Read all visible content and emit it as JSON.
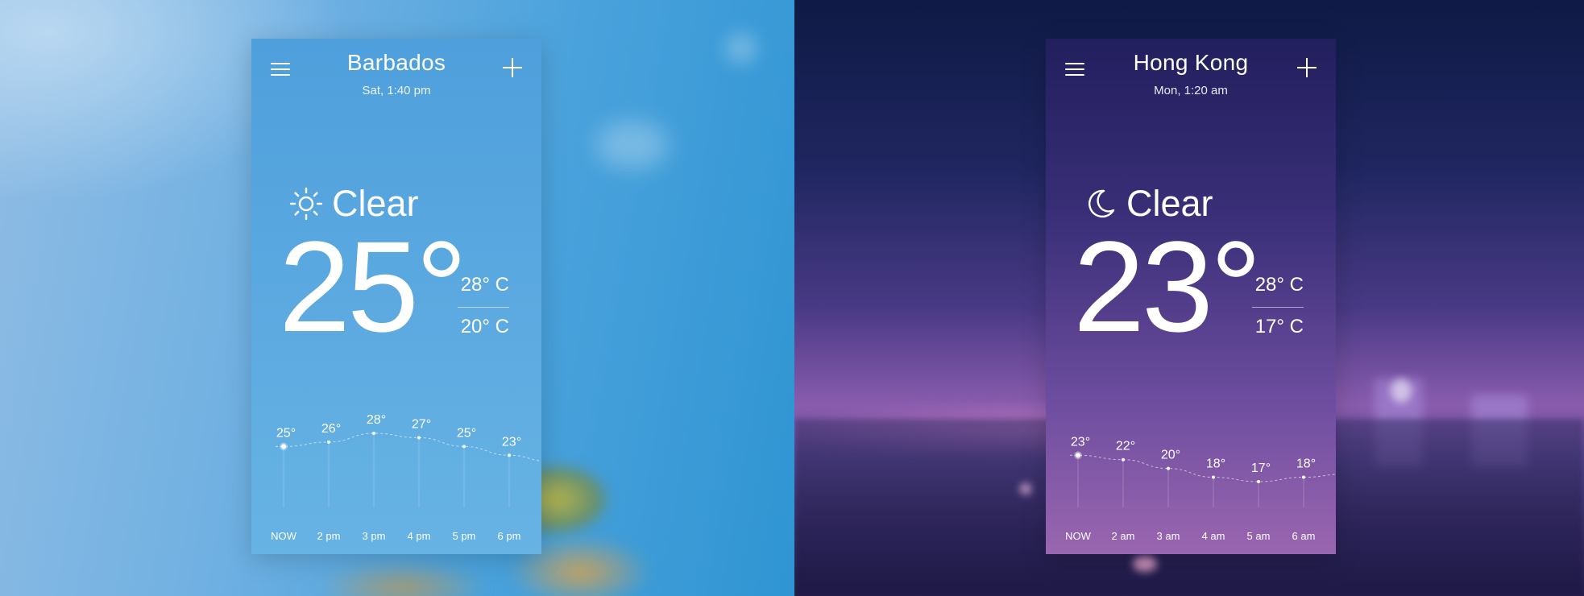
{
  "cards": {
    "barbados": {
      "city": "Barbados",
      "datetime": "Sat, 1:40 pm",
      "condition": "Clear",
      "condition_icon": "sun-icon",
      "temperature": "25°",
      "high": "28° C",
      "low": "20° C",
      "hourly": {
        "times": [
          "NOW",
          "2 pm",
          "3 pm",
          "4 pm",
          "5 pm",
          "6 pm"
        ],
        "temps": [
          25,
          26,
          28,
          27,
          25,
          23
        ]
      }
    },
    "hongkong": {
      "city": "Hong Kong",
      "datetime": "Mon, 1:20 am",
      "condition": "Clear",
      "condition_icon": "moon-icon",
      "temperature": "23°",
      "high": "28° C",
      "low": "17° C",
      "hourly": {
        "times": [
          "NOW",
          "2 am",
          "3 am",
          "4 am",
          "5 am",
          "6 am"
        ],
        "temps": [
          23,
          22,
          20,
          18,
          17,
          18
        ]
      }
    }
  },
  "icons": {
    "menu": "menu-icon",
    "add": "add-icon"
  },
  "colors": {
    "barbados_top": "#4e9fdc",
    "barbados_bottom": "#67b3e4",
    "hongkong_top": "#221f5e",
    "hongkong_bottom": "#9a66b0"
  }
}
